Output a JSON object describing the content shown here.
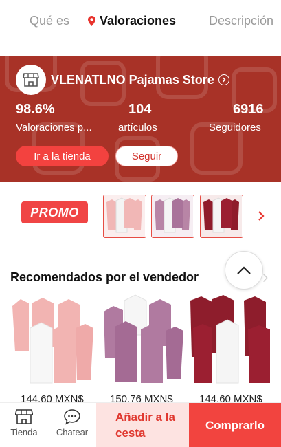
{
  "tabs": [
    {
      "label": "Qué es"
    },
    {
      "label": "Valoraciones"
    },
    {
      "label": "Descripción"
    }
  ],
  "store": {
    "name": "VLENATLNO Pajamas Store",
    "stats": [
      {
        "value": "98.6%",
        "label": "Valoraciones p..."
      },
      {
        "value": "104",
        "label": "artículos"
      },
      {
        "value": "6916",
        "label": "Seguidores"
      }
    ],
    "go_label": "Ir a la tienda",
    "follow_label": "Seguir",
    "banner_color": "#a83227"
  },
  "promo": {
    "label": "PROMO"
  },
  "recommended": {
    "title": "Recomendados por el vendedor",
    "products": [
      {
        "price": "144,60 MXN$",
        "color": "#f2b4b2"
      },
      {
        "price": "150,76 MXN$",
        "color": "#b07aa0"
      },
      {
        "price": "144,60 MXN$",
        "color": "#8e1d2c"
      }
    ]
  },
  "bottom_bar": {
    "store_label": "Tienda",
    "chat_label": "Chatear",
    "cart_label": "Añadir a la cesta",
    "buy_label": "Comprarlo"
  }
}
